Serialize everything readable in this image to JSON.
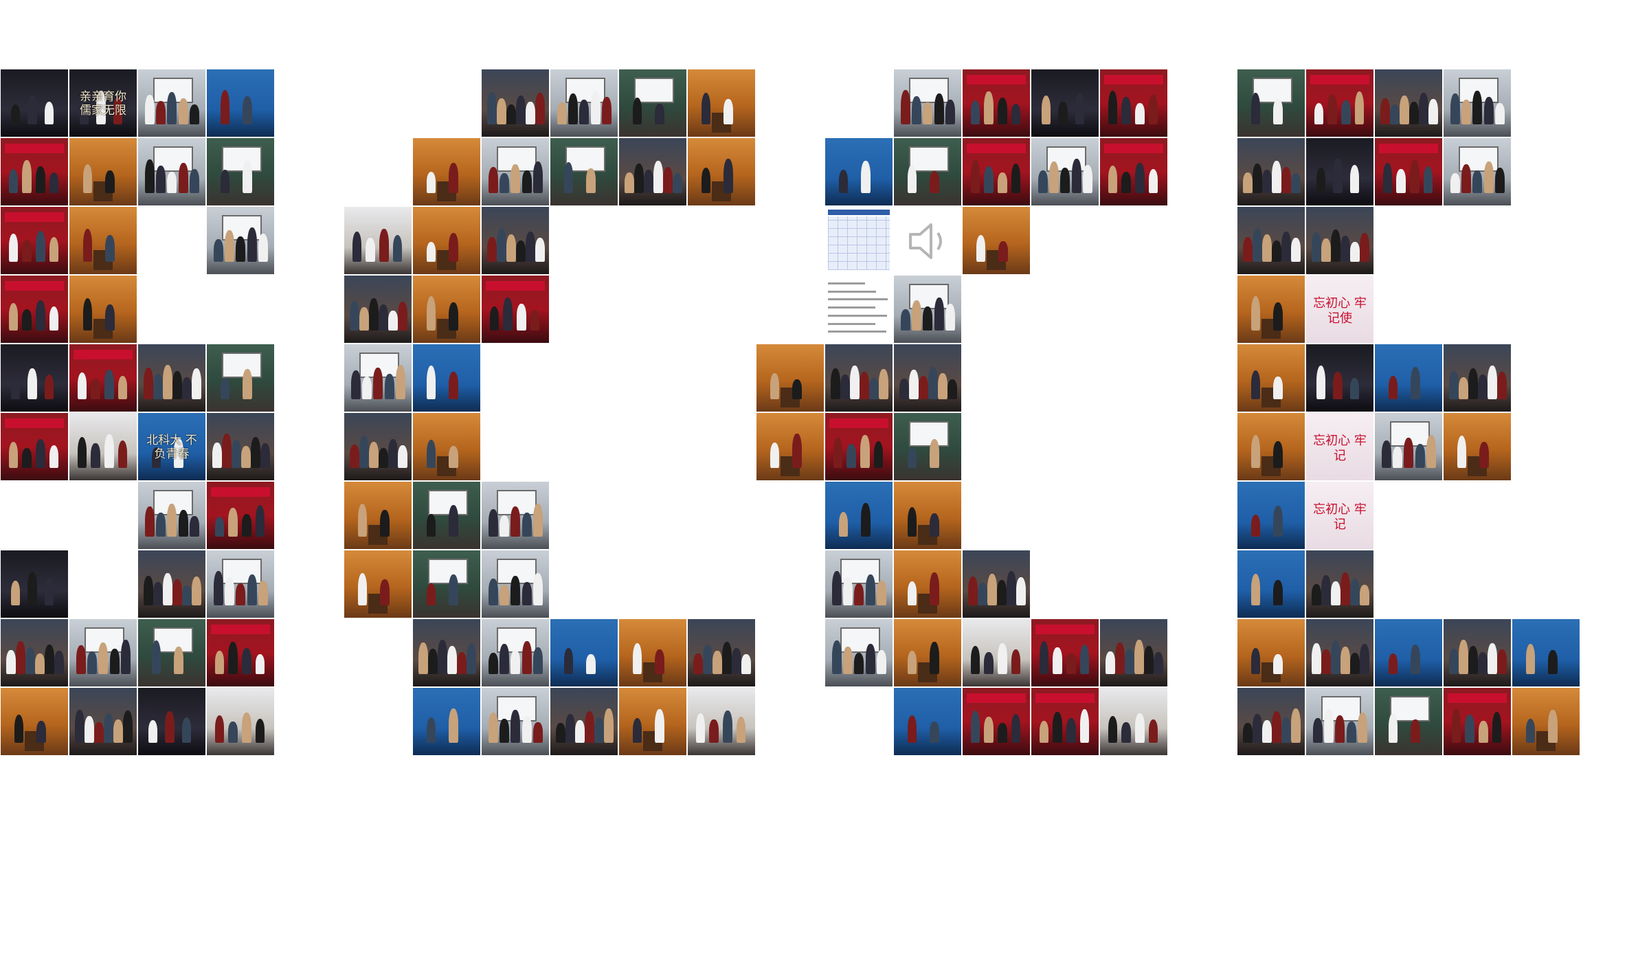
{
  "image": {
    "description_type": "photo-mosaic",
    "background": "#ffffff"
  },
  "tile_captions": {
    "slogan_1": "亲亲育你 儒家无限",
    "slogan_2": "北科大 不负青春",
    "slogan_3": "忘初心 牢记使",
    "slogan_4": "忘初心 牢记"
  },
  "palette": {
    "wood": "#b5651d",
    "stage_red": "#a3141f",
    "classroom_green": "#3e5e4f",
    "screen_blue": "#1f5fa8",
    "dark_hall": "#1b1b22",
    "crowd_mix": "#5a4a44",
    "flag_red": "#c8102e"
  }
}
